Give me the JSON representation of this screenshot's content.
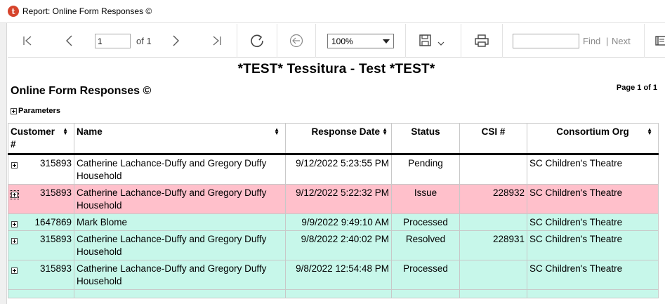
{
  "window": {
    "title": "Report: Online Form Responses ©",
    "app_logo_glyph": "t"
  },
  "toolbar": {
    "page_value": "1",
    "of_label": "of 1",
    "zoom_value": "100%",
    "find_label": "Find",
    "pipe": "|",
    "next_label": "Next",
    "icons": [
      "first-page-icon",
      "prev-page-icon",
      "next-page-icon",
      "last-page-icon",
      "refresh-icon",
      "back-icon",
      "save-icon",
      "print-icon",
      "panel-icon"
    ]
  },
  "report": {
    "heading": "*TEST* Tessitura - Test *TEST*",
    "subtitle": "Online Form Responses ©",
    "page_of": "Page 1 of 1",
    "parameters_label": "Parameters"
  },
  "table": {
    "columns": [
      {
        "label": "Customer #",
        "sortable": true
      },
      {
        "label": "Name",
        "sortable": true
      },
      {
        "label": "Response Date",
        "sortable": true
      },
      {
        "label": "Status",
        "sortable": false
      },
      {
        "label": "CSI #",
        "sortable": false
      },
      {
        "label": "Consortium Org",
        "sortable": true
      }
    ],
    "col0_line1": "Customer",
    "col0_line2": "#",
    "rows": [
      {
        "customer": "315893",
        "name_l1": "Catherine Lachance-Duffy and Gregory Duffy",
        "name_l2": "Household",
        "date": "9/12/2022 5:23:55 PM",
        "status": "Pending",
        "csi": "",
        "org": "SC Children's Theatre"
      },
      {
        "customer": "315893",
        "name_l1": "Catherine Lachance-Duffy and Gregory Duffy",
        "name_l2": "Household",
        "date": "9/12/2022 5:22:32 PM",
        "status": "Issue",
        "csi": "228932",
        "org": "SC Children's Theatre"
      },
      {
        "customer": "1647869",
        "name_l1": "Mark Blome",
        "name_l2": "",
        "date": "9/9/2022 9:49:10 AM",
        "status": "Processed",
        "csi": "",
        "org": "SC Children's Theatre"
      },
      {
        "customer": "315893",
        "name_l1": "Catherine Lachance-Duffy and Gregory Duffy",
        "name_l2": "Household",
        "date": "9/8/2022 2:40:02 PM",
        "status": "Resolved",
        "csi": "228931",
        "org": "SC Children's Theatre"
      },
      {
        "customer": "315893",
        "name_l1": "Catherine Lachance-Duffy and Gregory Duffy",
        "name_l2": "Household",
        "date": "9/8/2022 12:54:48 PM",
        "status": "Processed",
        "csi": "",
        "org": "SC Children's Theatre"
      }
    ],
    "status_colors": {
      "Pending": "#ffffff",
      "Issue": "#ffc0cb",
      "Processed": "#c7f7ea",
      "Resolved": "#c7f7ea"
    }
  }
}
